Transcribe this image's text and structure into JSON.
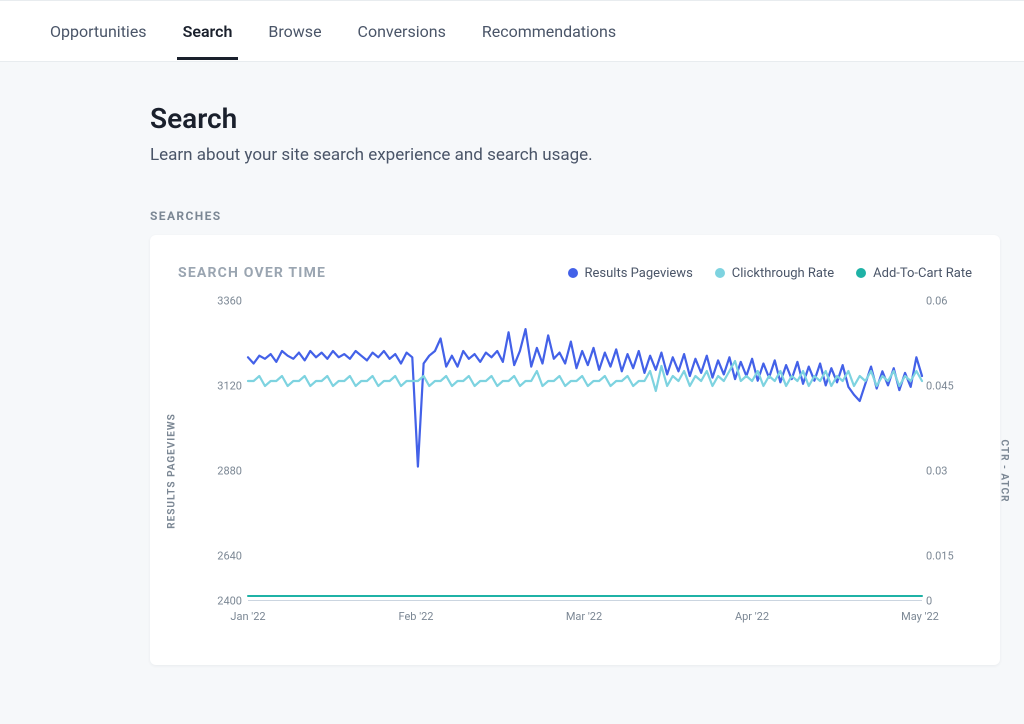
{
  "tabs": {
    "items": [
      "Opportunities",
      "Search",
      "Browse",
      "Conversions",
      "Recommendations"
    ],
    "active": 1
  },
  "page": {
    "title": "Search",
    "subtitle": "Learn about your site search experience and search usage."
  },
  "section": {
    "label": "SEARCHES"
  },
  "card": {
    "title": "SEARCH OVER TIME",
    "legend": [
      {
        "name": "Results Pageviews",
        "color": "#4361e8"
      },
      {
        "name": "Clickthrough Rate",
        "color": "#7ed3e0"
      },
      {
        "name": "Add-To-Cart Rate",
        "color": "#1fb2a6"
      }
    ],
    "yAxisLeft": {
      "label": "RESULTS PAGEVIEWS",
      "ticks": [
        "3360",
        "3120",
        "2880",
        "2640",
        "2400"
      ]
    },
    "yAxisRight": {
      "label": "CTR - ATCR",
      "ticks": [
        "0.06",
        "0.045",
        "0.03",
        "0.015",
        "0"
      ]
    },
    "xAxis": {
      "ticks": [
        "Jan '22",
        "Feb '22",
        "Mar '22",
        "Apr '22",
        "May '22"
      ]
    }
  },
  "chart_data": {
    "type": "line",
    "title": "Search Over Time",
    "xlabel": "",
    "ylabel_left": "Results Pageviews",
    "ylabel_right": "CTR - ATCR",
    "ylim_left": [
      2400,
      3360
    ],
    "ylim_right": [
      0,
      0.06
    ],
    "x": [
      "Jan '22",
      "Feb '22",
      "Mar '22",
      "Apr '22",
      "May '22"
    ],
    "daily_points": 120,
    "series": [
      {
        "name": "Results Pageviews",
        "axis": "left",
        "color": "#4361e8",
        "values": [
          3180,
          3160,
          3185,
          3175,
          3190,
          3165,
          3200,
          3185,
          3175,
          3195,
          3170,
          3200,
          3180,
          3195,
          3175,
          3200,
          3180,
          3190,
          3175,
          3200,
          3185,
          3170,
          3195,
          3180,
          3200,
          3175,
          3190,
          3160,
          3195,
          3180,
          2830,
          3160,
          3185,
          3200,
          3240,
          3150,
          3185,
          3150,
          3200,
          3175,
          3190,
          3165,
          3195,
          3180,
          3200,
          3165,
          3260,
          3155,
          3200,
          3270,
          3150,
          3210,
          3160,
          3250,
          3175,
          3195,
          3160,
          3230,
          3145,
          3200,
          3155,
          3210,
          3140,
          3195,
          3150,
          3205,
          3135,
          3190,
          3145,
          3200,
          3130,
          3185,
          3140,
          3195,
          3125,
          3180,
          3135,
          3190,
          3120,
          3175,
          3130,
          3185,
          3115,
          3170,
          3125,
          3180,
          3110,
          3165,
          3120,
          3175,
          3105,
          3160,
          3115,
          3170,
          3100,
          3155,
          3110,
          3165,
          3095,
          3150,
          3105,
          3160,
          3090,
          3145,
          3100,
          3155,
          3085,
          3060,
          3040,
          3095,
          3150,
          3080,
          3135,
          3090,
          3145,
          3075,
          3130,
          3085,
          3180,
          3120
        ],
        "notable_dip": {
          "approx_date": "late Jan '22",
          "value": 2830
        }
      },
      {
        "name": "Clickthrough Rate",
        "axis": "right",
        "color": "#7ed3e0",
        "values": [
          0.044,
          0.044,
          0.045,
          0.043,
          0.044,
          0.044,
          0.045,
          0.043,
          0.044,
          0.044,
          0.045,
          0.043,
          0.044,
          0.044,
          0.045,
          0.043,
          0.044,
          0.044,
          0.045,
          0.043,
          0.044,
          0.044,
          0.045,
          0.043,
          0.044,
          0.044,
          0.045,
          0.043,
          0.044,
          0.044,
          0.044,
          0.045,
          0.043,
          0.044,
          0.044,
          0.045,
          0.043,
          0.044,
          0.044,
          0.045,
          0.043,
          0.044,
          0.044,
          0.045,
          0.043,
          0.044,
          0.044,
          0.045,
          0.043,
          0.044,
          0.044,
          0.046,
          0.043,
          0.044,
          0.044,
          0.045,
          0.043,
          0.044,
          0.044,
          0.045,
          0.043,
          0.044,
          0.044,
          0.045,
          0.043,
          0.044,
          0.044,
          0.045,
          0.043,
          0.044,
          0.044,
          0.046,
          0.042,
          0.047,
          0.043,
          0.045,
          0.044,
          0.046,
          0.043,
          0.045,
          0.044,
          0.046,
          0.043,
          0.045,
          0.044,
          0.046,
          0.048,
          0.044,
          0.045,
          0.044,
          0.046,
          0.043,
          0.045,
          0.044,
          0.046,
          0.043,
          0.045,
          0.044,
          0.046,
          0.043,
          0.045,
          0.044,
          0.046,
          0.043,
          0.045,
          0.044,
          0.046,
          0.043,
          0.045,
          0.044,
          0.046,
          0.043,
          0.045,
          0.044,
          0.046,
          0.043,
          0.045,
          0.044,
          0.046,
          0.044
        ],
        "approx_mean": 0.044
      },
      {
        "name": "Add-To-Cart Rate",
        "axis": "right",
        "color": "#1fb2a6",
        "values": [
          0.001,
          0.001,
          0.001,
          0.001,
          0.001,
          0.001,
          0.001,
          0.001,
          0.001,
          0.001,
          0.001,
          0.001,
          0.001,
          0.001,
          0.001,
          0.001,
          0.001,
          0.001,
          0.001,
          0.001,
          0.001,
          0.001,
          0.001,
          0.001,
          0.001,
          0.001,
          0.001,
          0.001,
          0.001,
          0.001,
          0.001,
          0.001,
          0.001,
          0.001,
          0.001,
          0.001,
          0.001,
          0.001,
          0.001,
          0.001,
          0.001,
          0.001,
          0.001,
          0.001,
          0.001,
          0.001,
          0.001,
          0.001,
          0.001,
          0.001,
          0.001,
          0.001,
          0.001,
          0.001,
          0.001,
          0.001,
          0.001,
          0.001,
          0.001,
          0.001,
          0.001,
          0.001,
          0.001,
          0.001,
          0.001,
          0.001,
          0.001,
          0.001,
          0.001,
          0.001,
          0.001,
          0.001,
          0.001,
          0.001,
          0.001,
          0.001,
          0.001,
          0.001,
          0.001,
          0.001,
          0.001,
          0.001,
          0.001,
          0.001,
          0.001,
          0.001,
          0.001,
          0.001,
          0.001,
          0.001,
          0.001,
          0.001,
          0.001,
          0.001,
          0.001,
          0.001,
          0.001,
          0.001,
          0.001,
          0.001,
          0.001,
          0.001,
          0.001,
          0.001,
          0.001,
          0.001,
          0.001,
          0.001,
          0.001,
          0.001,
          0.001,
          0.001,
          0.001,
          0.001,
          0.001,
          0.001,
          0.001,
          0.001,
          0.001,
          0.001
        ],
        "approx_mean": 0.001
      }
    ]
  }
}
